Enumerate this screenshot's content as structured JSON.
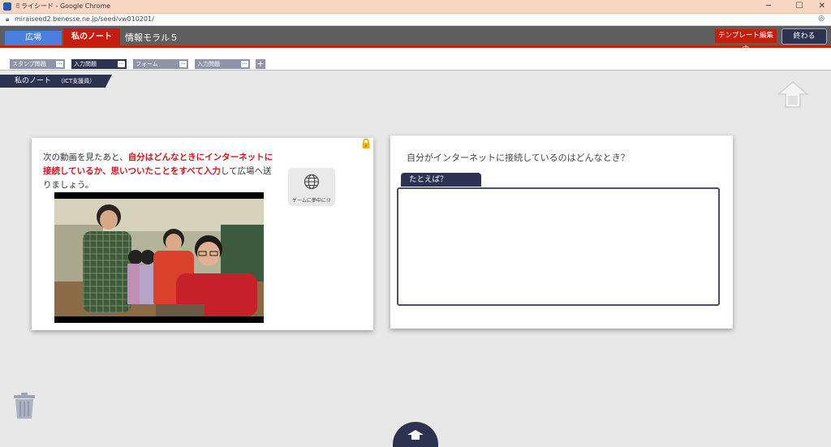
{
  "window": {
    "title": "ミライシード - Google Chrome",
    "minimize": "─",
    "maximize": "☐",
    "close": "✕"
  },
  "browser": {
    "url": "miraiseed2.benesse.ne.jp/seed/vw010201/"
  },
  "header": {
    "tab_plaza": "広場",
    "tab_note": "私のノート",
    "lesson_title": "情報モラル５",
    "template_edit": "テンプレート編集中",
    "end": "終わる"
  },
  "page_tabs": [
    {
      "label": "スタンプ問題",
      "active": false
    },
    {
      "label": "入力問題",
      "active": true
    },
    {
      "label": "フォーム",
      "active": false
    },
    {
      "label": "入力問題",
      "active": false
    }
  ],
  "page_tab_menu": "…",
  "add_tab": "+",
  "note_label": {
    "title": "私のノート",
    "subtitle": "（ICT支援員）"
  },
  "left_card": {
    "instruction_part1": "次の動画を見たあと、",
    "instruction_red": "自分はどんなときにインターネットに接続しているか、思いついたことをすべて入力",
    "instruction_part2": "して広場へ送りましょう。",
    "link_label": "ゲームに夢中に!?"
  },
  "right_card": {
    "question": "自分がインターネットに接続しているのはどんなとき？",
    "example_tab": "たとえば？"
  },
  "colors": {
    "accent_red": "#c51d0e",
    "navy": "#2b3350",
    "plaza_blue": "#4a7fe0"
  }
}
